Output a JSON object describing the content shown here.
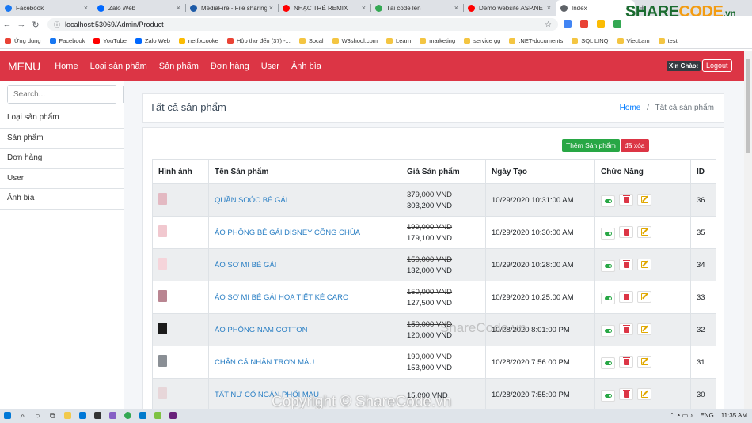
{
  "browser": {
    "tabs": [
      {
        "label": "Facebook",
        "icon": "facebook-icon",
        "color": "#1877f2"
      },
      {
        "label": "Zalo Web",
        "icon": "zalo-icon",
        "color": "#0068ff"
      },
      {
        "label": "MediaFire - File sharing",
        "icon": "mediafire-icon",
        "color": "#1d5aa7"
      },
      {
        "label": "NHẠC TRẺ REMIX",
        "icon": "youtube-icon",
        "color": "#ff0000"
      },
      {
        "label": "Tải code lên",
        "icon": "sharecode-icon",
        "color": "#34a853"
      },
      {
        "label": "Demo website ASP.NE",
        "icon": "youtube-icon",
        "color": "#ff0000"
      },
      {
        "label": "Index",
        "icon": "globe-icon",
        "color": "#5f6368"
      }
    ],
    "url": "localhost:53069/Admin/Product",
    "bookmarks": [
      {
        "label": "Ứng dụng",
        "color": "#e94235"
      },
      {
        "label": "Facebook",
        "color": "#1877f2"
      },
      {
        "label": "YouTube",
        "color": "#ff0000"
      },
      {
        "label": "Zalo Web",
        "color": "#0068ff"
      },
      {
        "label": "netfixcooke",
        "color": "#fbbc04"
      },
      {
        "label": "Hộp thư đến (37) -...",
        "color": "#ea4335"
      },
      {
        "label": "Socal",
        "color": "#f4c542"
      },
      {
        "label": "W3shool.com",
        "color": "#f4c542"
      },
      {
        "label": "Learn",
        "color": "#f4c542"
      },
      {
        "label": "marketing",
        "color": "#f4c542"
      },
      {
        "label": "service gg",
        "color": "#f4c542"
      },
      {
        "label": ".NET-documents",
        "color": "#f4c542"
      },
      {
        "label": "SQL LINQ",
        "color": "#f4c542"
      },
      {
        "label": "ViecLam",
        "color": "#f4c542"
      },
      {
        "label": "test",
        "color": "#f4c542"
      }
    ],
    "logo": {
      "part1": "SHARE",
      "part2": "CODE",
      "suffix": ".vn"
    }
  },
  "navbar": {
    "brand": "MENU",
    "links": [
      "Home",
      "Loại sản phẩm",
      "Sản phẩm",
      "Đơn hàng",
      "User",
      "Ảnh bìa"
    ],
    "greeting": "Xin Chào:",
    "logout": "Logout",
    "color": "#dc3545"
  },
  "sidebar": {
    "search_placeholder": "Search...",
    "items": [
      "Loại sản phẩm",
      "Sản phẩm",
      "Đơn hàng",
      "User",
      "Ảnh bìa"
    ]
  },
  "page": {
    "title": "Tất cả sản phẩm",
    "breadcrumb_home": "Home",
    "breadcrumb_sep": "/",
    "breadcrumb_current": "Tất cả sản phẩm",
    "add_button": "Thêm Sản phẩm",
    "deleted_button": "đã xóa"
  },
  "table": {
    "headers": [
      "Hình ảnh",
      "Tên Sản phẩm",
      "Giá Sản phẩm",
      "Ngày Tạo",
      "Chức Năng",
      "ID"
    ],
    "rows": [
      {
        "name": "QUẦN SOÓC BÉ GÁI",
        "old_price": "379,000 VND",
        "price": "303,200 VND",
        "date": "10/29/2020 10:31:00 AM",
        "id": "36",
        "thumb": "#e3b9c2"
      },
      {
        "name": "ÁO PHÔNG BÉ GÁI DISNEY CÔNG CHÚA",
        "old_price": "199,000 VND",
        "price": "179,100 VND",
        "date": "10/29/2020 10:30:00 AM",
        "id": "35",
        "thumb": "#f1c8cf"
      },
      {
        "name": "ÁO SƠ MI BÉ GÁI",
        "old_price": "150,000 VND",
        "price": "132,000 VND",
        "date": "10/29/2020 10:28:00 AM",
        "id": "34",
        "thumb": "#f5d4da"
      },
      {
        "name": "ÁO SƠ MI BÉ GÁI HỌA TIẾT KẺ CARO",
        "old_price": "150,000 VND",
        "price": "127,500 VND",
        "date": "10/29/2020 10:25:00 AM",
        "id": "33",
        "thumb": "#b98591"
      },
      {
        "name": "ÁO PHÔNG NAM COTTON",
        "old_price": "150,000 VND",
        "price": "120,000 VND",
        "date": "10/28/2020 8:01:00 PM",
        "id": "32",
        "thumb": "#1b1b1b"
      },
      {
        "name": "CHÂN CÁ NHÂN TRƠN MÀU",
        "old_price": "190,000 VND",
        "price": "153,900 VND",
        "date": "10/28/2020 7:56:00 PM",
        "id": "31",
        "thumb": "#8a8f95"
      },
      {
        "name": "TẤT NỮ CỔ NGẮN PHỐI MÀU",
        "old_price": "",
        "price": "15,000 VND",
        "date": "10/28/2020 7:55:00 PM",
        "id": "30",
        "thumb": "#e7d6d9"
      }
    ]
  },
  "watermarks": {
    "mid": "ShareCode.vn",
    "bottom": "Copyright © ShareCode.vn"
  },
  "taskbar": {
    "lang": "ENG",
    "time": "11:35 AM"
  }
}
